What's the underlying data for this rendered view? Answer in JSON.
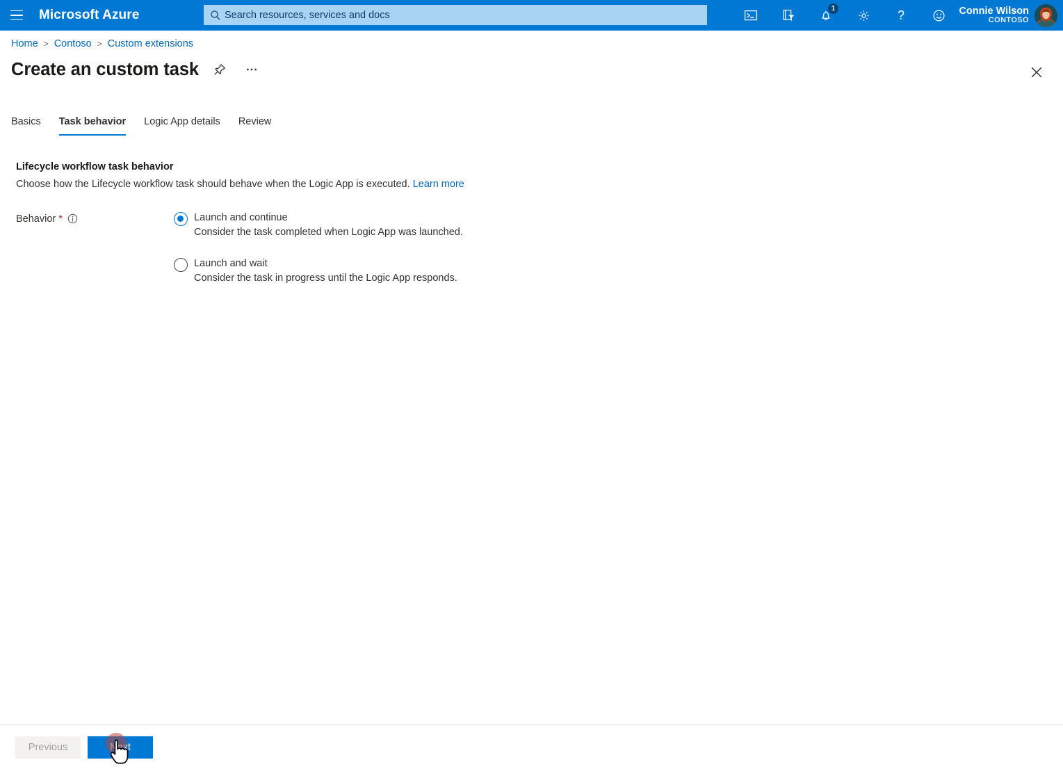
{
  "header": {
    "menu_icon": "hamburger-icon",
    "brand": "Microsoft Azure",
    "search": {
      "icon": "search-icon",
      "placeholder": "Search resources, services and docs",
      "value": ""
    },
    "icons": [
      {
        "name": "cloud-shell-icon",
        "label": "Cloud Shell"
      },
      {
        "name": "directories-filter-icon",
        "label": "Directories + subscriptions"
      },
      {
        "name": "notifications-bell-icon",
        "label": "Notifications",
        "badge": "1"
      },
      {
        "name": "settings-gear-icon",
        "label": "Settings"
      },
      {
        "name": "help-question-icon",
        "label": "Help"
      },
      {
        "name": "feedback-smiley-icon",
        "label": "Feedback"
      }
    ],
    "user": {
      "name": "Connie Wilson",
      "tenant": "CONTOSO",
      "avatar": "user-avatar"
    }
  },
  "breadcrumb": [
    {
      "label": "Home"
    },
    {
      "label": "Contoso"
    },
    {
      "label": "Custom extensions"
    }
  ],
  "breadcrumb_separator": ">",
  "title": {
    "text": "Create an custom task",
    "pin_icon": "pin-icon",
    "more_icon": "more-ellipsis-icon",
    "close_icon": "close-icon"
  },
  "tabs": [
    {
      "label": "Basics",
      "active": false
    },
    {
      "label": "Task behavior",
      "active": true
    },
    {
      "label": "Logic App details",
      "active": false
    },
    {
      "label": "Review",
      "active": false
    }
  ],
  "section": {
    "heading": "Lifecycle workflow task behavior",
    "description": "Choose how the Lifecycle workflow task should behave when the Logic App is executed.",
    "learn_more": "Learn more"
  },
  "field": {
    "label": "Behavior",
    "required_mark": "*",
    "info_icon": "info-icon",
    "options": [
      {
        "label": "Launch and continue",
        "description": "Consider the task completed when Logic App was launched.",
        "selected": true
      },
      {
        "label": "Launch and wait",
        "description": "Consider the task in progress until the Logic App responds.",
        "selected": false
      }
    ]
  },
  "footer": {
    "previous_label": "Previous",
    "next_label": "Next"
  },
  "colors": {
    "azure_blue": "#0078d4",
    "link_blue": "#0067b8",
    "search_fill": "#a8d3f2",
    "required_red": "#a4262c",
    "badge_blue": "#004578",
    "disabled_bg": "#f3f2f1"
  }
}
